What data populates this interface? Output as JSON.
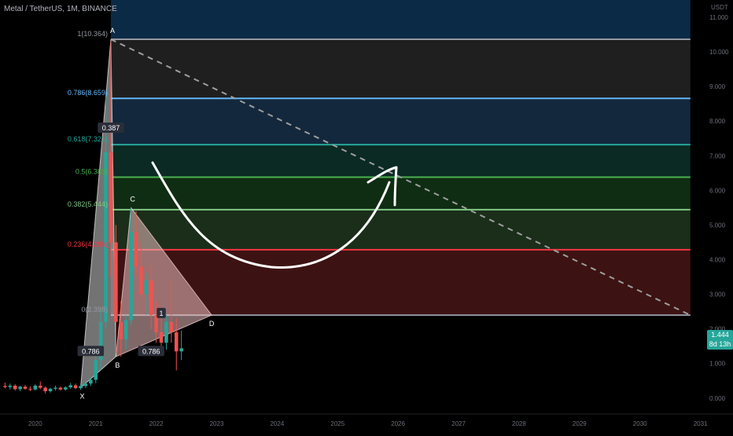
{
  "chart": {
    "title": "Metal / TetherUS, 1M, BINANCE",
    "unit": "USDT"
  },
  "colors": {
    "background": "#000000",
    "up": "#26a69a",
    "down": "#ef5350",
    "level_1": "#9598a1",
    "level_0786": "#64b5f6",
    "level_0618": "#26a69a",
    "level_05": "#4caf50",
    "level_0382": "#81c784",
    "level_0236": "#f23645",
    "level_0": "#9598a1"
  },
  "current_price": {
    "value": "1.444",
    "countdown": "8d 13h"
  },
  "chart_data": {
    "type": "candlestick",
    "title": "Metal / TetherUS, 1M, BINANCE",
    "y_unit": "USDT",
    "y_ticks": [
      "0.000",
      "1.000",
      "2.000",
      "3.000",
      "4.000",
      "5.000",
      "6.000",
      "7.000",
      "8.000",
      "9.000",
      "10.000",
      "11.000"
    ],
    "ylim": [
      -0.3,
      11.5
    ],
    "x_ticks": [
      "2020",
      "2021",
      "2022",
      "2023",
      "2024",
      "2025",
      "2026",
      "2027",
      "2028",
      "2029",
      "2030",
      "2031"
    ],
    "xlim": [
      "2019-06",
      "2031-02"
    ],
    "candles": [
      {
        "t": "2019-07",
        "o": 0.35,
        "h": 0.45,
        "l": 0.28,
        "c": 0.32
      },
      {
        "t": "2019-08",
        "o": 0.32,
        "h": 0.42,
        "l": 0.25,
        "c": 0.36
      },
      {
        "t": "2019-09",
        "o": 0.36,
        "h": 0.4,
        "l": 0.22,
        "c": 0.26
      },
      {
        "t": "2019-10",
        "o": 0.26,
        "h": 0.36,
        "l": 0.2,
        "c": 0.33
      },
      {
        "t": "2019-11",
        "o": 0.33,
        "h": 0.38,
        "l": 0.24,
        "c": 0.27
      },
      {
        "t": "2019-12",
        "o": 0.27,
        "h": 0.34,
        "l": 0.2,
        "c": 0.25
      },
      {
        "t": "2020-01",
        "o": 0.25,
        "h": 0.4,
        "l": 0.22,
        "c": 0.36
      },
      {
        "t": "2020-02",
        "o": 0.36,
        "h": 0.48,
        "l": 0.26,
        "c": 0.3
      },
      {
        "t": "2020-03",
        "o": 0.3,
        "h": 0.34,
        "l": 0.14,
        "c": 0.2
      },
      {
        "t": "2020-04",
        "o": 0.2,
        "h": 0.3,
        "l": 0.16,
        "c": 0.27
      },
      {
        "t": "2020-05",
        "o": 0.27,
        "h": 0.36,
        "l": 0.22,
        "c": 0.3
      },
      {
        "t": "2020-06",
        "o": 0.3,
        "h": 0.34,
        "l": 0.22,
        "c": 0.25
      },
      {
        "t": "2020-07",
        "o": 0.25,
        "h": 0.34,
        "l": 0.22,
        "c": 0.31
      },
      {
        "t": "2020-08",
        "o": 0.31,
        "h": 0.44,
        "l": 0.27,
        "c": 0.37
      },
      {
        "t": "2020-09",
        "o": 0.37,
        "h": 0.42,
        "l": 0.26,
        "c": 0.29
      },
      {
        "t": "2020-10",
        "o": 0.29,
        "h": 0.4,
        "l": 0.24,
        "c": 0.35
      },
      {
        "t": "2020-11",
        "o": 0.35,
        "h": 0.5,
        "l": 0.29,
        "c": 0.42
      },
      {
        "t": "2020-12",
        "o": 0.42,
        "h": 0.6,
        "l": 0.35,
        "c": 0.53
      },
      {
        "t": "2021-01",
        "o": 0.53,
        "h": 1.25,
        "l": 0.43,
        "c": 1.1
      },
      {
        "t": "2021-02",
        "o": 1.1,
        "h": 2.6,
        "l": 0.8,
        "c": 2.2
      },
      {
        "t": "2021-03",
        "o": 2.2,
        "h": 8.8,
        "l": 2.0,
        "c": 7.1
      },
      {
        "t": "2021-04",
        "o": 7.1,
        "h": 10.3,
        "l": 3.5,
        "c": 4.5
      },
      {
        "t": "2021-05",
        "o": 4.5,
        "h": 5.0,
        "l": 1.3,
        "c": 2.2
      },
      {
        "t": "2021-06",
        "o": 2.2,
        "h": 2.8,
        "l": 1.2,
        "c": 1.7
      },
      {
        "t": "2021-07",
        "o": 1.7,
        "h": 2.4,
        "l": 1.4,
        "c": 2.25
      },
      {
        "t": "2021-08",
        "o": 2.25,
        "h": 5.5,
        "l": 2.1,
        "c": 4.8
      },
      {
        "t": "2021-09",
        "o": 4.8,
        "h": 5.4,
        "l": 3.5,
        "c": 3.8
      },
      {
        "t": "2021-10",
        "o": 3.8,
        "h": 4.5,
        "l": 2.9,
        "c": 3.0
      },
      {
        "t": "2021-11",
        "o": 3.0,
        "h": 3.6,
        "l": 2.4,
        "c": 3.4
      },
      {
        "t": "2021-12",
        "o": 3.4,
        "h": 3.8,
        "l": 2.0,
        "c": 2.4
      },
      {
        "t": "2022-01",
        "o": 2.4,
        "h": 2.8,
        "l": 1.6,
        "c": 1.9
      },
      {
        "t": "2022-02",
        "o": 1.9,
        "h": 2.3,
        "l": 1.5,
        "c": 1.6
      },
      {
        "t": "2022-03",
        "o": 1.6,
        "h": 2.4,
        "l": 1.4,
        "c": 2.2
      },
      {
        "t": "2022-04",
        "o": 2.2,
        "h": 3.4,
        "l": 1.6,
        "c": 1.9
      },
      {
        "t": "2022-05",
        "o": 1.9,
        "h": 2.3,
        "l": 0.8,
        "c": 1.35
      },
      {
        "t": "2022-06",
        "o": 1.35,
        "h": 1.95,
        "l": 1.1,
        "c": 1.44
      }
    ],
    "fib_levels": [
      {
        "label": "1(10.364)",
        "value": 10.364,
        "color_key": "level_1"
      },
      {
        "label": "0.786(8.659)",
        "value": 8.659,
        "color_key": "level_0786"
      },
      {
        "label": "0.618(7.321)",
        "value": 7.321,
        "color_key": "level_0618"
      },
      {
        "label": "0.5(6.383)",
        "value": 6.383,
        "color_key": "level_05"
      },
      {
        "label": "0.382(5.444)",
        "value": 5.444,
        "color_key": "level_0382"
      },
      {
        "label": "0.236(4.286)",
        "value": 4.286,
        "color_key": "level_0236"
      },
      {
        "label": "0(2.398)",
        "value": 2.398,
        "color_key": "level_0"
      }
    ],
    "harmonic_points": [
      {
        "label": "X",
        "t": "2020-10",
        "v": 0.3
      },
      {
        "label": "A",
        "t": "2021-04",
        "v": 10.364
      },
      {
        "label": "B",
        "t": "2021-05",
        "v": 1.2
      },
      {
        "label": "C",
        "t": "2021-08",
        "v": 5.5
      },
      {
        "label": "D",
        "t": "2022-12",
        "v": 2.398
      }
    ],
    "harmonic_ratios": [
      {
        "text": "0.387",
        "t": "2021-04",
        "v": 7.8
      },
      {
        "text": "0.786",
        "t": "2020-12",
        "v": 1.35
      },
      {
        "text": "0.786",
        "t": "2021-12",
        "v": 1.35
      },
      {
        "text": "1",
        "t": "2022-02",
        "v": 2.45
      }
    ],
    "trendline": {
      "from": {
        "t": "2021-04",
        "v": 10.364
      },
      "to": {
        "t": "2030-11",
        "v": 2.398
      }
    }
  }
}
